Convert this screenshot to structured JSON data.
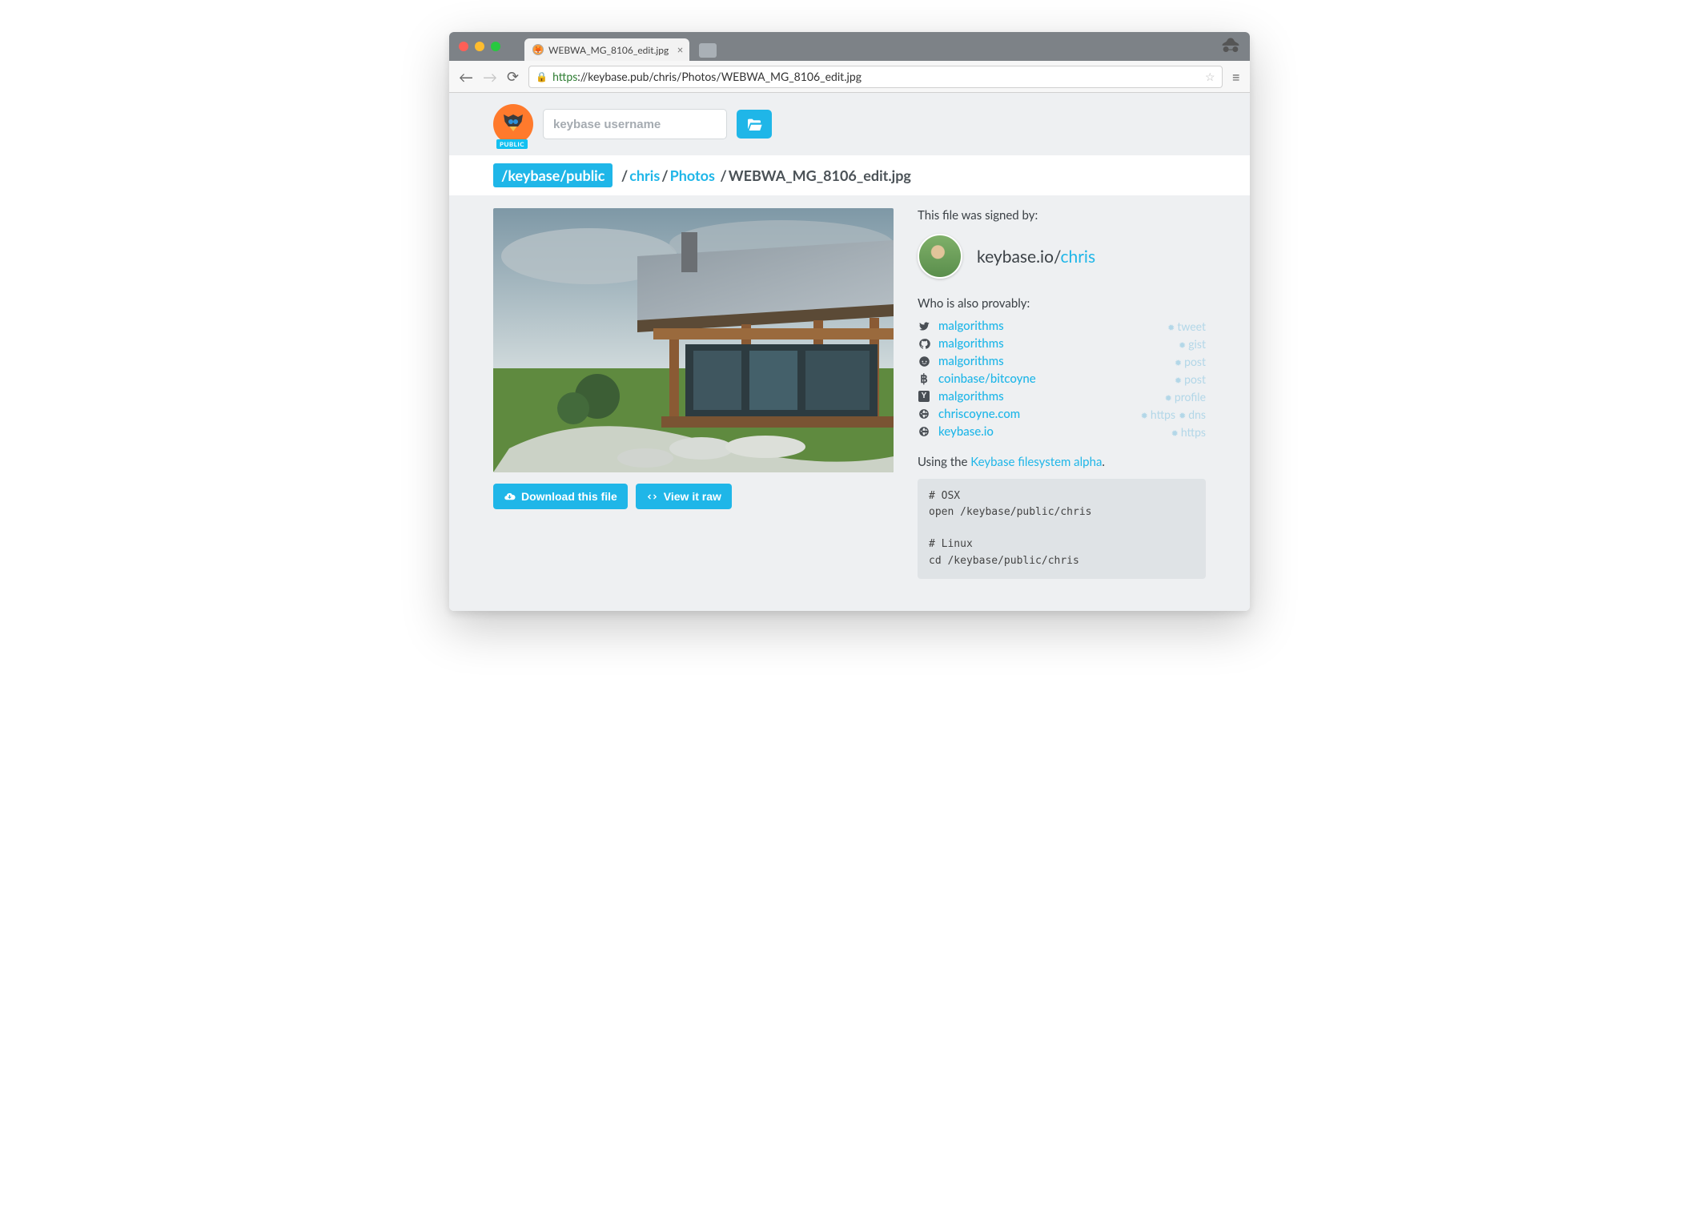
{
  "browser": {
    "tab_title": "WEBWA_MG_8106_edit.jpg",
    "url_scheme": "https",
    "url_rest": "://keybase.pub/chris/Photos/WEBWA_MG_8106_edit.jpg"
  },
  "header": {
    "logo_badge": "PUBLIC",
    "search_placeholder": "keybase username"
  },
  "breadcrumb": {
    "root": "/keybase/public",
    "segments": [
      "chris",
      "Photos"
    ],
    "current": "WEBWA_MG_8106_edit.jpg"
  },
  "buttons": {
    "download": "Download this file",
    "view_raw": "View it raw"
  },
  "sidebar": {
    "signed_by_label": "This file was signed by:",
    "profile_prefix": "keybase.io/",
    "profile_user": "chris",
    "provably_label": "Who is also provably:",
    "proofs": [
      {
        "service": "twitter",
        "handle": "malgorithms",
        "badges": [
          "tweet"
        ]
      },
      {
        "service": "github",
        "handle": "malgorithms",
        "badges": [
          "gist"
        ]
      },
      {
        "service": "reddit",
        "handle": "malgorithms",
        "badges": [
          "post"
        ]
      },
      {
        "service": "bitcoin",
        "handle": "coinbase/bitcoyne",
        "badges": [
          "post"
        ]
      },
      {
        "service": "hn",
        "handle": "malgorithms",
        "badges": [
          "profile"
        ]
      },
      {
        "service": "web",
        "handle": "chriscoyne.com",
        "badges": [
          "https",
          "dns"
        ]
      },
      {
        "service": "web",
        "handle": "keybase.io",
        "badges": [
          "https"
        ]
      }
    ],
    "fs_line_prefix": "Using the ",
    "fs_link": "Keybase filesystem alpha",
    "fs_line_suffix": ".",
    "terminal": "# OSX\nopen /keybase/public/chris\n\n# Linux\ncd /keybase/public/chris"
  }
}
